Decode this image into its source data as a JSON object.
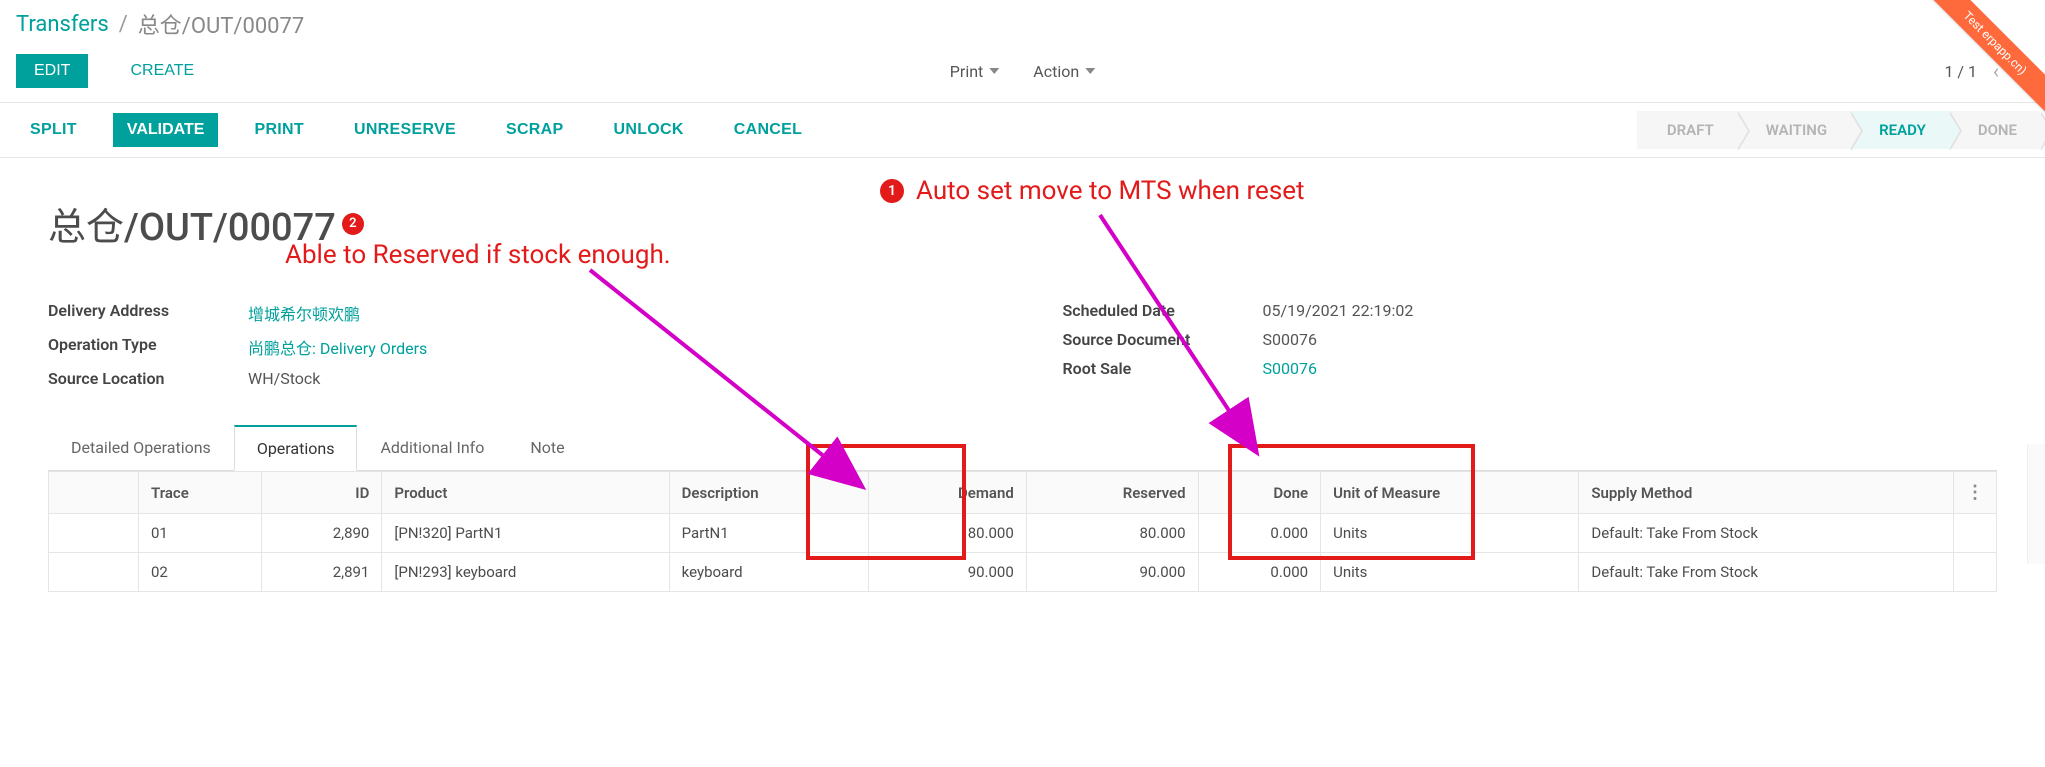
{
  "breadcrumb": {
    "root": "Transfers",
    "current": "总仓/OUT/00077"
  },
  "actions": {
    "edit": "EDIT",
    "create": "CREATE",
    "print": "Print",
    "action": "Action"
  },
  "pager": {
    "text": "1 / 1"
  },
  "workflow": {
    "split": "SPLIT",
    "validate": "VALIDATE",
    "print": "PRINT",
    "unreserve": "UNRESERVE",
    "scrap": "SCRAP",
    "unlock": "UNLOCK",
    "cancel": "CANCEL"
  },
  "statuses": {
    "draft": "DRAFT",
    "waiting": "WAITING",
    "ready": "READY",
    "done": "DONE"
  },
  "title": "总仓/OUT/00077",
  "title_badge": "2",
  "annotations": {
    "num1": "1",
    "mts": "Auto set move to MTS when reset",
    "reserved": "Able to Reserved if stock enough."
  },
  "fields": {
    "col1": [
      {
        "label": "Delivery Address",
        "value": "增城希尔顿欢鹏",
        "link": true
      },
      {
        "label": "Operation Type",
        "value": "尚鹏总仓: Delivery Orders",
        "link": true
      },
      {
        "label": "Source Location",
        "value": "WH/Stock",
        "link": false
      }
    ],
    "col2": [
      {
        "label": "Scheduled Date",
        "value": "05/19/2021 22:19:02",
        "link": false
      },
      {
        "label": "Source Document",
        "value": "S00076",
        "link": false
      },
      {
        "label": "Root Sale",
        "value": "S00076",
        "link": true
      }
    ]
  },
  "tabs": {
    "t1": "Detailed Operations",
    "t2": "Operations",
    "t3": "Additional Info",
    "t4": "Note"
  },
  "table": {
    "headers": {
      "trace": "Trace",
      "id": "ID",
      "product": "Product",
      "description": "Description",
      "demand": "Demand",
      "reserved": "Reserved",
      "done": "Done",
      "uom": "Unit of Measure",
      "supply": "Supply Method"
    },
    "rows": [
      {
        "trace": "01",
        "id": "2,890",
        "product": "[PN!320] PartN1",
        "description": "PartN1",
        "demand": "80.000",
        "reserved": "80.000",
        "done": "0.000",
        "uom": "Units",
        "supply": "Default: Take From Stock"
      },
      {
        "trace": "02",
        "id": "2,891",
        "product": "[PN!293] keyboard",
        "description": "keyboard",
        "demand": "90.000",
        "reserved": "90.000",
        "done": "0.000",
        "uom": "Units",
        "supply": "Default: Take From Stock"
      }
    ]
  },
  "ribbon": "Test erpapp.cn)"
}
